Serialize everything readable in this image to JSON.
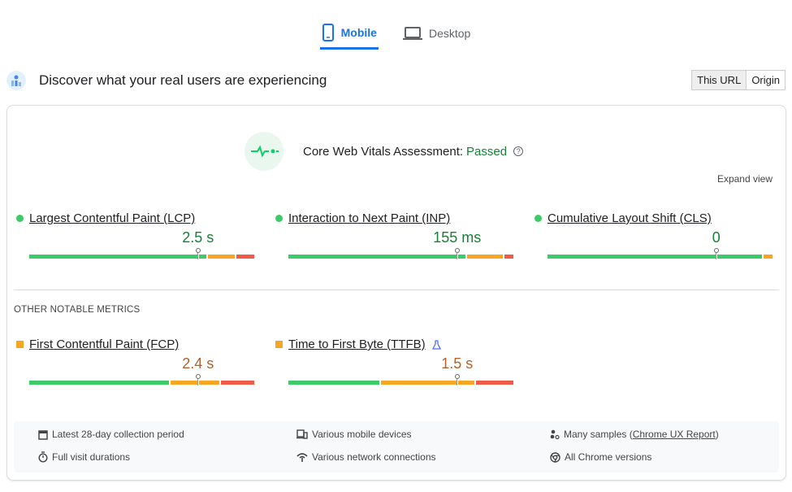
{
  "tabs": [
    {
      "label": "Mobile",
      "active": true,
      "icon": "phone-icon"
    },
    {
      "label": "Desktop",
      "active": false,
      "icon": "laptop-icon"
    }
  ],
  "header": {
    "title": "Discover what your real users are experiencing",
    "toggle": [
      "This URL",
      "Origin"
    ]
  },
  "assessment": {
    "label": "Core Web Vitals Assessment:",
    "status": "Passed",
    "help": "?",
    "expand": "Expand view"
  },
  "colors": {
    "good": "#3ccb69",
    "ni": "#f7a522",
    "poor": "#f05a47",
    "good_text": "#188038",
    "ni_text": "#b0622f"
  },
  "core_metrics": [
    {
      "name": "Largest Contentful Paint (LCP)",
      "value": "2.5 s",
      "rating": "good",
      "dist": [
        80,
        12,
        8
      ],
      "marker": 75
    },
    {
      "name": "Interaction to Next Paint (INP)",
      "value": "155 ms",
      "rating": "good",
      "dist": [
        79,
        16,
        4
      ],
      "marker": 75
    },
    {
      "name": "Cumulative Layout Shift (CLS)",
      "value": "0",
      "rating": "good",
      "dist": [
        96,
        4,
        0
      ],
      "marker": 75
    }
  ],
  "other_label": "OTHER NOTABLE METRICS",
  "other_metrics": [
    {
      "name": "First Contentful Paint (FCP)",
      "value": "2.4 s",
      "rating": "ni",
      "dist": [
        63,
        22,
        15
      ],
      "marker": 75
    },
    {
      "name": "Time to First Byte (TTFB)",
      "value": "1.5 s",
      "rating": "ni",
      "dist": [
        41,
        42,
        17
      ],
      "marker": 75,
      "experimental": true
    }
  ],
  "footer": {
    "period": "Latest 28-day collection period",
    "devices": "Various mobile devices",
    "samples_pre": "Many samples (",
    "samples_link": "Chrome UX Report",
    "samples_post": ")",
    "durations": "Full visit durations",
    "network": "Various network connections",
    "versions": "All Chrome versions"
  }
}
